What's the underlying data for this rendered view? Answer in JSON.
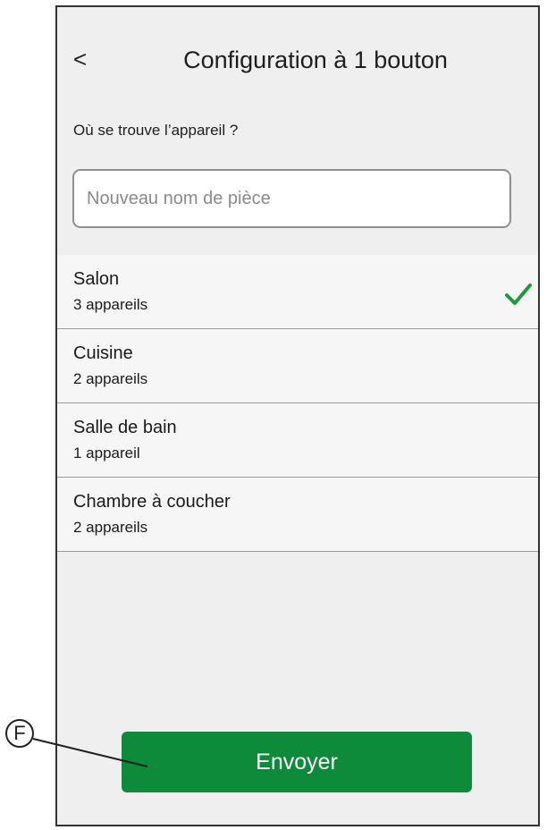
{
  "header": {
    "back_icon": "chevron-left-icon",
    "back_glyph": "<",
    "title": "Configuration à 1 bouton"
  },
  "question": "Où se trouve l’appareil ?",
  "room_input": {
    "value": "",
    "placeholder": "Nouveau nom de pièce"
  },
  "rooms": [
    {
      "name": "Salon",
      "count": "3 appareils",
      "selected": true
    },
    {
      "name": "Cuisine",
      "count": "2 appareils",
      "selected": false
    },
    {
      "name": "Salle de bain",
      "count": "1 appareil",
      "selected": false
    },
    {
      "name": "Chambre à coucher",
      "count": "2 appareils",
      "selected": false
    }
  ],
  "check_icon": "checkmark-icon",
  "colors": {
    "accent": "#0d8a3a",
    "check": "#1e9a3c"
  },
  "send_button": {
    "label": "Envoyer"
  },
  "callout": {
    "label": "F"
  }
}
